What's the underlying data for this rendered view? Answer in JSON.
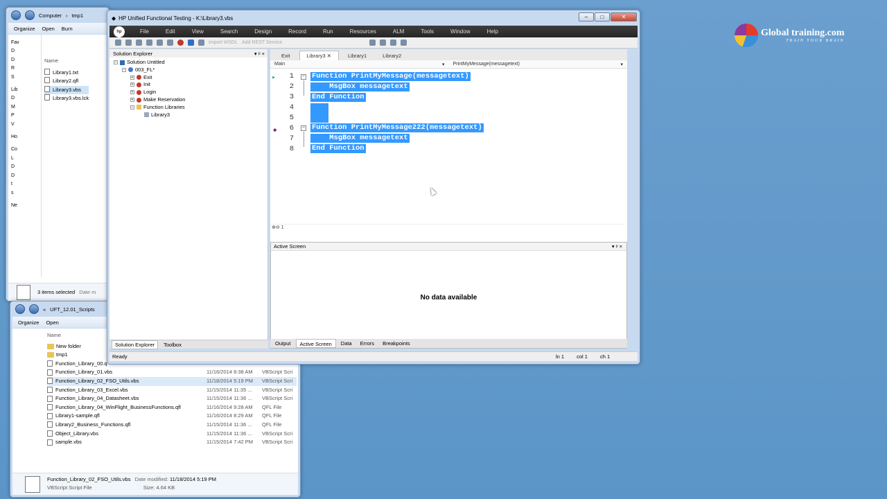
{
  "brand": {
    "name": "Global training.com",
    "tagline": "TRAIN YOUR BRAIN"
  },
  "uft": {
    "title": "HP Unified Functional Testing - K:\\Library3.vbs",
    "menu": [
      "File",
      "Edit",
      "View",
      "Search",
      "Design",
      "Record",
      "Run",
      "Resources",
      "ALM",
      "Tools",
      "Window",
      "Help"
    ],
    "toolbar_disabled": [
      "Import WSDL",
      "Add REST Service"
    ],
    "solution_explorer": {
      "title": "Solution Explorer",
      "tree": [
        {
          "label": "Solution Untitled",
          "level": 0
        },
        {
          "label": "003_FL*",
          "level": 1
        },
        {
          "label": "Exit",
          "level": 2
        },
        {
          "label": "Init",
          "level": 2
        },
        {
          "label": "Login",
          "level": 2
        },
        {
          "label": "Make Reservation",
          "level": 2
        },
        {
          "label": "Function Libraries",
          "level": 2
        },
        {
          "label": "Library3",
          "level": 3
        }
      ],
      "tabs": [
        "Solution Explorer",
        "Toolbox"
      ]
    },
    "editor": {
      "tabs": [
        "Exit",
        "Library3",
        "Library1",
        "Library2"
      ],
      "scope": "Main",
      "function_combo": "PrintMyMessage(messagetext)",
      "lines": [
        {
          "n": "1",
          "text": "Function PrintMyMessage(messagetext)"
        },
        {
          "n": "2",
          "text": "    MsgBox messagetext"
        },
        {
          "n": "3",
          "text": "End Function"
        },
        {
          "n": "4",
          "text": ""
        },
        {
          "n": "5",
          "text": ""
        },
        {
          "n": "6",
          "text": "Function PrintMyMessage222(messagetext)"
        },
        {
          "n": "7",
          "text": "    MsgBox messagetext"
        },
        {
          "n": "8",
          "text": "End Function"
        }
      ],
      "zoom_level": "1"
    },
    "active_screen": {
      "title": "Active Screen",
      "message": "No data available"
    },
    "bottom_tabs": [
      "Output",
      "Active Screen",
      "Data",
      "Errors",
      "Breakpoints"
    ],
    "status": {
      "text": "Ready",
      "ln": "ln 1",
      "col": "col 1",
      "ch": "ch 1"
    }
  },
  "explorer1": {
    "address": [
      "Computer",
      "tmp1"
    ],
    "toolbar": [
      "Organize",
      "Open",
      "Burn"
    ],
    "column": "Name",
    "files": [
      "Library1.txt",
      "Library2.qfl",
      "Library3.vbs",
      "Library3.vbs.lck"
    ],
    "nav": [
      "Fav",
      "D",
      "D",
      "R",
      "S",
      "Lib",
      "D",
      "M",
      "P",
      "V",
      "Ho",
      "Co",
      "L",
      "D",
      "D",
      "t",
      "s",
      "Ne"
    ],
    "status": "3 items selected",
    "status2": "Date m"
  },
  "explorer2": {
    "address": [
      "«",
      "UFT_12.01_Scripts"
    ],
    "toolbar": [
      "Organize",
      "Open"
    ],
    "column": "Name",
    "files": [
      {
        "name": "New folder",
        "date": "",
        "type": "",
        "folder": true
      },
      {
        "name": "tmp1",
        "date": "",
        "type": "",
        "folder": true
      },
      {
        "name": "Function_Library_00.q",
        "date": "",
        "type": ""
      },
      {
        "name": "Function_Library_01.vbs",
        "date": "11/16/2014 8:38 AM",
        "type": "VBScript Scri"
      },
      {
        "name": "Function_Library_02_FSO_Utils.vbs",
        "date": "11/18/2014 5:19 PM",
        "type": "VBScript Scri"
      },
      {
        "name": "Function_Library_03_Excel.vbs",
        "date": "11/15/2014 11:35 ...",
        "type": "VBScript Scri"
      },
      {
        "name": "Function_Library_04_Datasheet.vbs",
        "date": "11/15/2014 11:36 ...",
        "type": "VBScript Scri"
      },
      {
        "name": "Function_Library_04_WinFlight_BusinessFunctions.qfl",
        "date": "11/16/2014 9:28 AM",
        "type": "QFL File"
      },
      {
        "name": "Library1-sample.qfl",
        "date": "11/16/2014 8:29 AM",
        "type": "QFL File"
      },
      {
        "name": "Library2_Business_Functions.qfl",
        "date": "11/15/2014 11:36 ...",
        "type": "QFL File"
      },
      {
        "name": "Object_Library.vbs",
        "date": "11/15/2014 11:36 ...",
        "type": "VBScript Scri"
      },
      {
        "name": "sample.vbs",
        "date": "11/15/2014 7:42 PM",
        "type": "VBScript Scri"
      }
    ],
    "details": {
      "name": "Function_Library_02_FSO_Utils.vbs",
      "modified_label": "Date modified:",
      "modified": "11/18/2014 5:19 PM",
      "type": "VBScript Script File",
      "size_label": "Size:",
      "size": "4.64 KB"
    }
  }
}
